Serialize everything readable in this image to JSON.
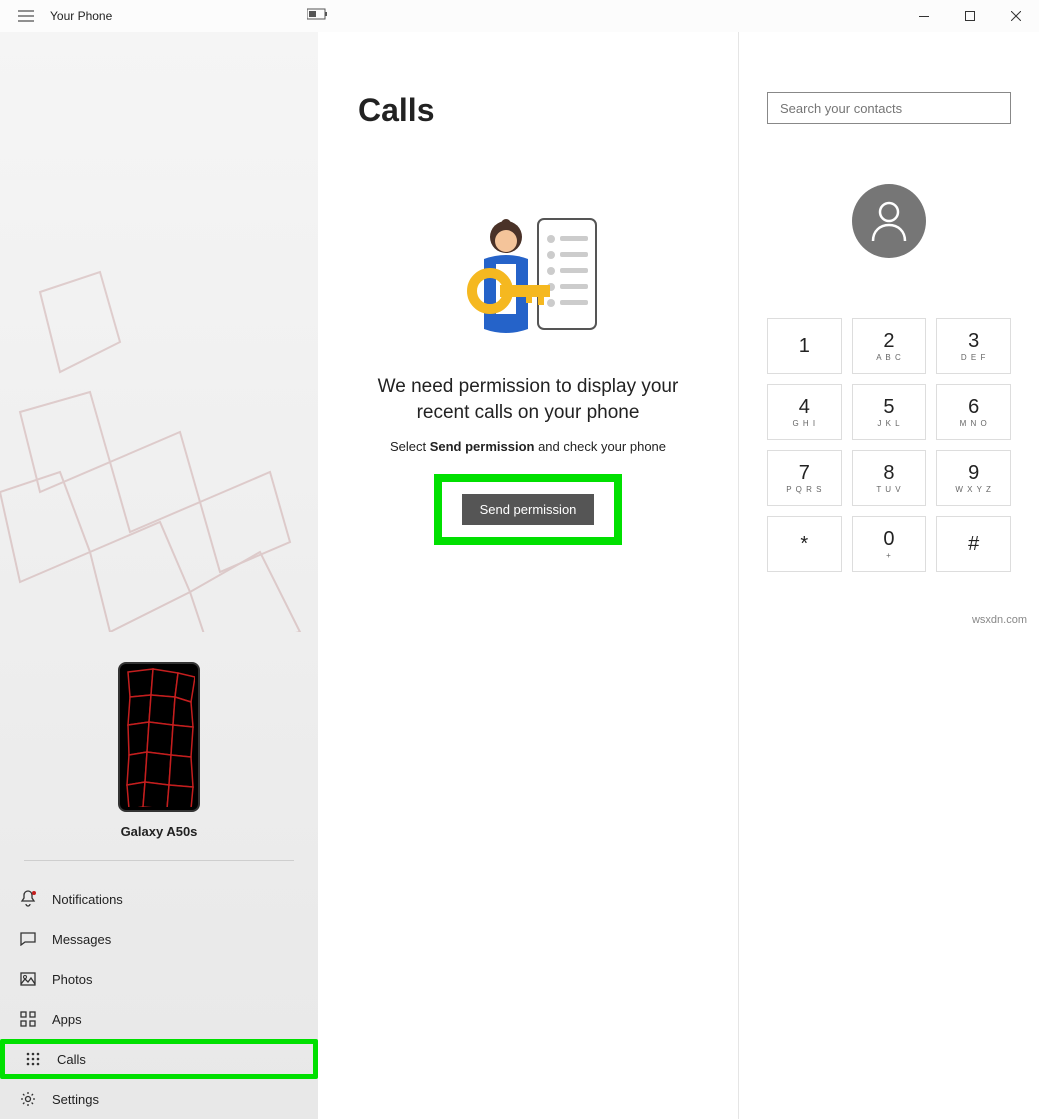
{
  "titlebar": {
    "app_title": "Your Phone"
  },
  "sidebar": {
    "phone_name": "Galaxy A50s",
    "items": [
      {
        "label": "Notifications",
        "icon": "bell"
      },
      {
        "label": "Messages",
        "icon": "message"
      },
      {
        "label": "Photos",
        "icon": "photo"
      },
      {
        "label": "Apps",
        "icon": "apps"
      },
      {
        "label": "Calls",
        "icon": "dialpad",
        "highlighted": true
      }
    ],
    "settings_label": "Settings"
  },
  "content": {
    "title": "Calls",
    "permission_title": "We need permission to display your recent calls on your phone",
    "permission_sub_1": "Select ",
    "permission_sub_strong": "Send permission",
    "permission_sub_2": " and check your phone",
    "send_button": "Send permission"
  },
  "right": {
    "search_placeholder": "Search your contacts",
    "dialpad": [
      {
        "num": "1",
        "letters": ""
      },
      {
        "num": "2",
        "letters": "A B C"
      },
      {
        "num": "3",
        "letters": "D E F"
      },
      {
        "num": "4",
        "letters": "G H I"
      },
      {
        "num": "5",
        "letters": "J K L"
      },
      {
        "num": "6",
        "letters": "M N O"
      },
      {
        "num": "7",
        "letters": "P Q R S"
      },
      {
        "num": "8",
        "letters": "T U V"
      },
      {
        "num": "9",
        "letters": "W X Y Z"
      },
      {
        "num": "*",
        "letters": ""
      },
      {
        "num": "0",
        "letters": "+"
      },
      {
        "num": "#",
        "letters": ""
      }
    ]
  },
  "watermark": "wsxdn.com"
}
